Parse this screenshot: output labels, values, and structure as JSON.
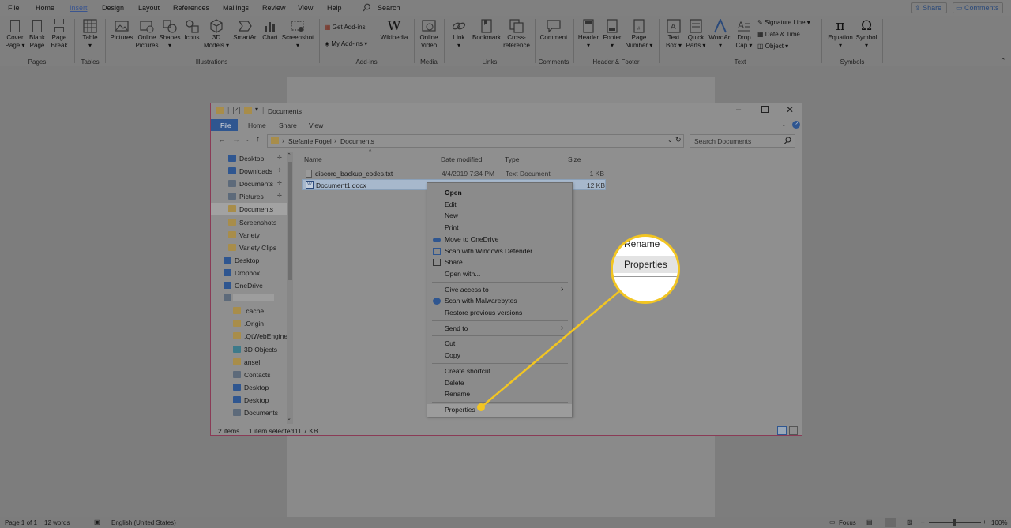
{
  "word": {
    "tabs": [
      "File",
      "Home",
      "Insert",
      "Design",
      "Layout",
      "References",
      "Mailings",
      "Review",
      "View",
      "Help"
    ],
    "active_tab": "Insert",
    "search_label": "Search",
    "share_label": "Share",
    "comments_label": "Comments",
    "ribbon": {
      "cover_page": "Cover\nPage ▾",
      "blank_page": "Blank\nPage",
      "page_break": "Page\nBreak",
      "table": "Table\n▾",
      "pictures": "Pictures",
      "online_pictures": "Online\nPictures",
      "shapes": "Shapes\n▾",
      "icons": "Icons",
      "models_3d": "3D\nModels ▾",
      "smartart": "SmartArt",
      "chart": "Chart",
      "screenshot": "Screenshot\n▾",
      "get_addins": "Get Add-ins",
      "my_addins": "My Add-ins",
      "wikipedia": "Wikipedia",
      "online_video": "Online\nVideo",
      "link": "Link\n▾",
      "bookmark": "Bookmark",
      "cross_reference": "Cross-\nreference",
      "comment": "Comment",
      "header": "Header\n▾",
      "footer": "Footer\n▾",
      "page_number": "Page\nNumber ▾",
      "text_box": "Text\nBox ▾",
      "quick_parts": "Quick\nParts ▾",
      "wordart": "WordArt\n▾",
      "drop_cap": "Drop\nCap ▾",
      "signature_line": "Signature Line",
      "date_time": "Date & Time",
      "object": "Object",
      "equation": "Equation\n▾",
      "symbol": "Symbol\n▾"
    },
    "groups": [
      "Pages",
      "Tables",
      "Illustrations",
      "Add-ins",
      "Media",
      "Links",
      "Comments",
      "Header & Footer",
      "Text",
      "Symbols"
    ],
    "status": {
      "page": "Page 1 of 1",
      "words": "12 words",
      "language": "English (United States)",
      "focus": "Focus",
      "zoom": "100%"
    }
  },
  "explorer": {
    "title": "Documents",
    "ribbon_tabs": [
      "File",
      "Home",
      "Share",
      "View"
    ],
    "breadcrumb": [
      "Stefanie Fogel",
      "Documents"
    ],
    "search_placeholder": "Search Documents",
    "nav_items": [
      {
        "label": "Desktop",
        "pinned": true,
        "icon": "desktop-icon"
      },
      {
        "label": "Downloads",
        "pinned": true,
        "icon": "download-icon"
      },
      {
        "label": "Documents",
        "pinned": true,
        "icon": "documents-icon"
      },
      {
        "label": "Pictures",
        "pinned": true,
        "icon": "pictures-icon"
      },
      {
        "label": "Documents",
        "pinned": false,
        "icon": "folder-icon"
      },
      {
        "label": "Screenshots",
        "pinned": false,
        "icon": "folder-icon"
      },
      {
        "label": "Variety",
        "pinned": false,
        "icon": "folder-icon"
      },
      {
        "label": "Variety Clips",
        "pinned": false,
        "icon": "folder-icon"
      },
      {
        "label": "Desktop",
        "pinned": false,
        "icon": "desktop-icon"
      },
      {
        "label": "Dropbox",
        "pinned": false,
        "icon": "dropbox-icon"
      },
      {
        "label": "OneDrive",
        "pinned": false,
        "icon": "cloud-icon"
      },
      {
        "label": "",
        "pinned": false,
        "icon": "user-icon"
      },
      {
        "label": ".cache",
        "pinned": false,
        "icon": "folder-icon"
      },
      {
        "label": ".Origin",
        "pinned": false,
        "icon": "folder-icon"
      },
      {
        "label": ".QtWebEngine",
        "pinned": false,
        "icon": "folder-icon"
      },
      {
        "label": "3D Objects",
        "pinned": false,
        "icon": "cube-icon"
      },
      {
        "label": "ansel",
        "pinned": false,
        "icon": "folder-icon"
      },
      {
        "label": "Contacts",
        "pinned": false,
        "icon": "contacts-icon"
      },
      {
        "label": "Desktop",
        "pinned": false,
        "icon": "desktop-icon"
      },
      {
        "label": "Desktop",
        "pinned": false,
        "icon": "desktop-icon"
      },
      {
        "label": "Documents",
        "pinned": false,
        "icon": "documents-icon"
      }
    ],
    "columns": [
      "Name",
      "Date modified",
      "Type",
      "Size"
    ],
    "files": [
      {
        "name": "discord_backup_codes.txt",
        "date": "4/4/2019 7:34 PM",
        "type": "Text Document",
        "size": "1 KB"
      },
      {
        "name": "Document1.docx",
        "date": "",
        "type": "",
        "size": "12 KB"
      }
    ],
    "status": {
      "items": "2 items",
      "selected": "1 item selected",
      "size": "11.7 KB"
    }
  },
  "context_menu": [
    {
      "label": "Open",
      "bold": true
    },
    {
      "label": "Edit"
    },
    {
      "label": "New"
    },
    {
      "label": "Print"
    },
    {
      "label": "Move to OneDrive",
      "icon": "cloud-icon"
    },
    {
      "label": "Scan with Windows Defender...",
      "icon": "defender-icon"
    },
    {
      "label": "Share",
      "icon": "share-icon"
    },
    {
      "label": "Open with..."
    },
    {
      "sep": true
    },
    {
      "label": "Give access to",
      "submenu": true
    },
    {
      "label": "Scan with Malwarebytes",
      "icon": "malwarebytes-icon"
    },
    {
      "label": "Restore previous versions"
    },
    {
      "sep": true
    },
    {
      "label": "Send to",
      "submenu": true
    },
    {
      "sep": true
    },
    {
      "label": "Cut"
    },
    {
      "label": "Copy"
    },
    {
      "sep": true
    },
    {
      "label": "Create shortcut"
    },
    {
      "label": "Delete"
    },
    {
      "label": "Rename"
    },
    {
      "sep": true
    },
    {
      "label": "Properties",
      "highlight": true
    }
  ],
  "magnifier": {
    "rename": "Rename",
    "properties": "Properties"
  },
  "colors": {
    "accent": "#f2c522",
    "word_blue": "#2b579a",
    "selection": "#a7b8cc"
  }
}
